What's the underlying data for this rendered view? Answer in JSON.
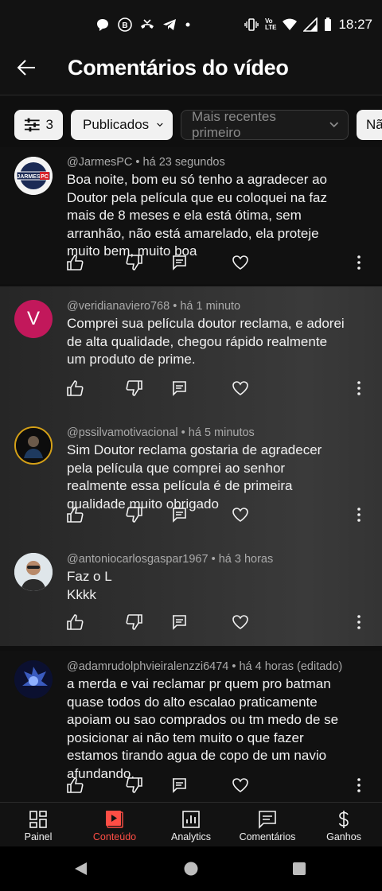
{
  "status_bar": {
    "time": "18:27",
    "network_label": "Vo\nLTE"
  },
  "header": {
    "title": "Comentários do vídeo"
  },
  "filters": {
    "filter_count": "3",
    "status_chip": "Publicados",
    "sort_chip": "Mais recentes primeiro",
    "extra_chip": "Nã"
  },
  "comments": [
    {
      "author": "@JarmesPC",
      "time": "há 23 segundos",
      "avatar_text": "JARMES PC",
      "text": "Boa noite, bom eu só tenho a agradecer ao Doutor pela película que eu coloquei na faz mais de 8 meses e ela está ótima, sem arranhão, não está amarelado, ela proteje muito bem, muito boa"
    },
    {
      "author": "@veridianaviero768",
      "time": "há 1 minuto",
      "avatar_text": "V",
      "text": "Comprei sua película doutor reclama, e adorei de alta qualidade, chegou rápido realmente um produto de prime."
    },
    {
      "author": "@pssilvamotivacional",
      "time": "há 5 minutos",
      "text": "Sim Doutor reclama gostaria de agradecer pela película que comprei ao senhor realmente essa película é de primeira qualidade muito obrigado"
    },
    {
      "author": "@antoniocarlosgaspar1967",
      "time": "há 3 horas",
      "text_lines": [
        "Faz o L",
        "Kkkk"
      ]
    },
    {
      "author": "@adamrudolphvieiralenzzi6474",
      "time": "há 4 horas (editado)",
      "text": "a merda e vai reclamar pr quem pro batman quase todos do alto escalao praticamente apoiam ou sao comprados ou tm medo de se posicionar ai não tem muito o que fazer estamos tirando agua de copo de um navio afundando."
    }
  ],
  "bottom_nav": [
    {
      "label": "Painel",
      "icon": "dashboard-icon"
    },
    {
      "label": "Conteúdo",
      "icon": "content-icon",
      "active": true
    },
    {
      "label": "Analytics",
      "icon": "analytics-icon"
    },
    {
      "label": "Comentários",
      "icon": "comments-icon"
    },
    {
      "label": "Ganhos",
      "icon": "earnings-icon"
    }
  ],
  "colors": {
    "background": "#0f0f0f",
    "highlight_background": "#2b2b2b",
    "accent": "#ff4e45",
    "text_primary": "#f1f1f1",
    "text_secondary": "#aaaaaa"
  }
}
